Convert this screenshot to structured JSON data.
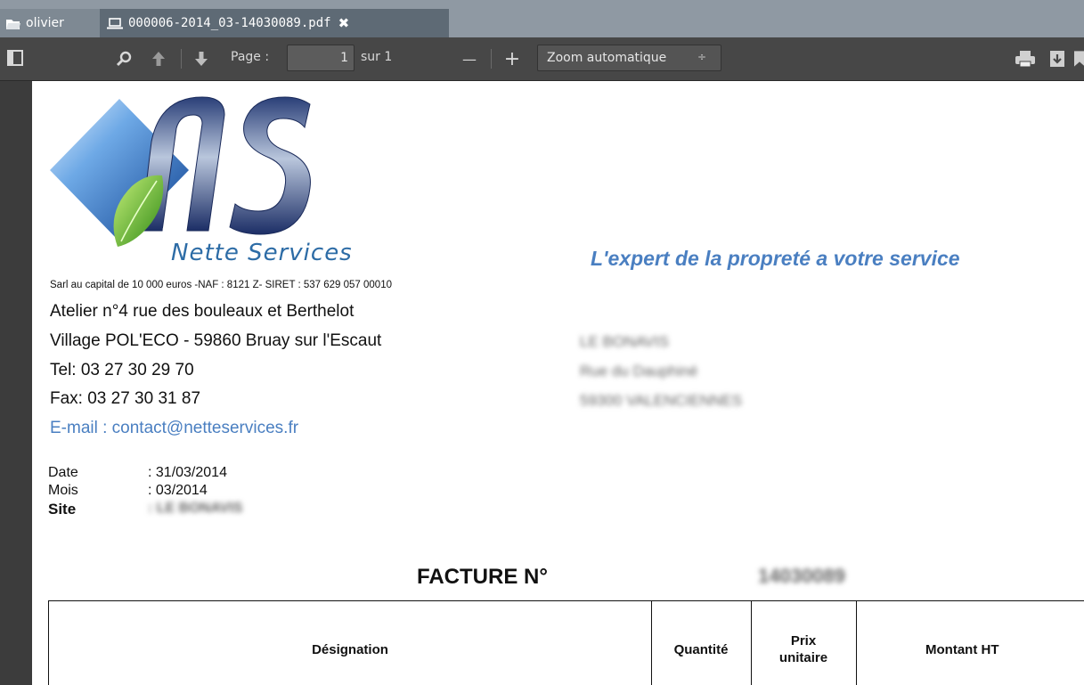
{
  "tabs": {
    "folder_label": "olivier",
    "pdf_label": "000006-2014_03-14030089.pdf",
    "close_symbol": "✖"
  },
  "toolbar": {
    "page_label": "Page :",
    "page_value": "1",
    "page_total": "sur 1",
    "zoom_minus": "—",
    "zoom_plus": "+",
    "zoom_value": "Zoom automatique",
    "zoom_arrow": "÷",
    "icons": [
      "sidebar-toggle-icon",
      "search-icon",
      "arrow-up-icon",
      "arrow-down-icon",
      "print-icon",
      "download-icon",
      "bookmark-icon"
    ]
  },
  "document": {
    "logo_text": "Nette Services",
    "slogan": "L'expert de la propreté a votre service",
    "legal": "Sarl au capital de 10 000 euros -NAF : 8121 Z- SIRET : 537 629 057 00010",
    "address_lines": [
      "Atelier n°4 rue des bouleaux et Berthelot",
      "Village POL'ECO - 59860 Bruay sur l'Escaut",
      "Tel: 03 27 30 29 70",
      "Fax: 03 27 30 31 87"
    ],
    "email": "E-mail : contact@netteservices.fr",
    "recipient_lines": [
      "LE BONAVIS",
      "Rue du Dauphiné",
      "59300 VALENCIENNES"
    ],
    "meta": [
      {
        "label": "Date",
        "value": ": 31/03/2014"
      },
      {
        "label": "Mois",
        "value": ": 03/2014"
      },
      {
        "label": "Site",
        "value": ": LE BONAVIS"
      }
    ],
    "invoice_title": "FACTURE N°",
    "invoice_number": "14030089",
    "table_headers": [
      "Désignation",
      "Quantité",
      "Prix unitaire",
      "Montant HT"
    ]
  },
  "colors": {
    "tabbar": "#8f99a3",
    "active_tab": "#5e6a75",
    "toolbar": "#474747",
    "link_blue": "#4a7fc1"
  }
}
